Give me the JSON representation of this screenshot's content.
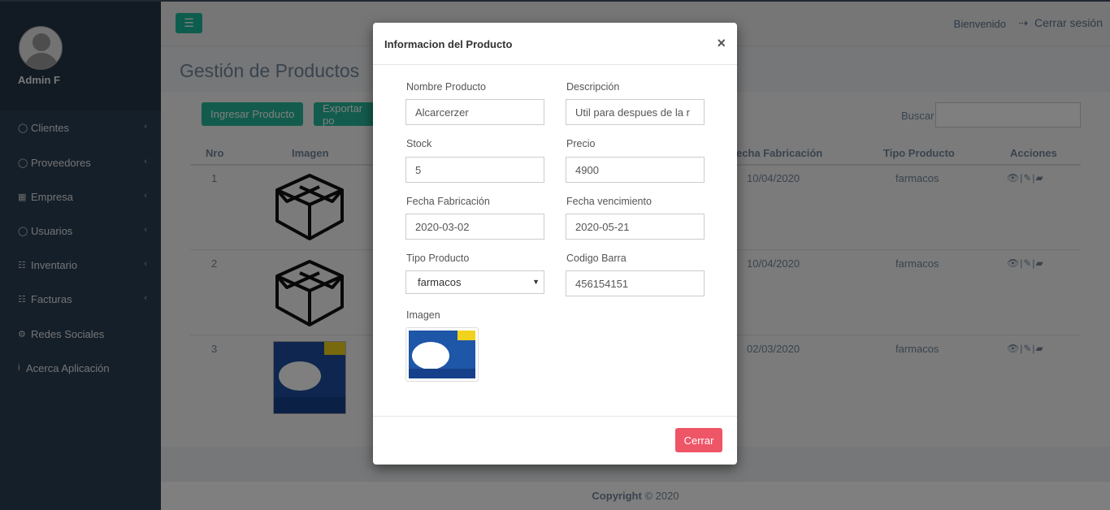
{
  "sidebar": {
    "user_name": "Admin F",
    "items": [
      {
        "label": "Clientes",
        "icon": "user-icon"
      },
      {
        "label": "Proveedores",
        "icon": "user-icon"
      },
      {
        "label": "Empresa",
        "icon": "building-icon"
      },
      {
        "label": "Usuarios",
        "icon": "user-icon"
      },
      {
        "label": "Inventario",
        "icon": "cart-icon"
      },
      {
        "label": "Facturas",
        "icon": "cart-icon"
      },
      {
        "label": "Redes Sociales",
        "icon": "gear-icon"
      },
      {
        "label": "Acerca Aplicación",
        "icon": "info-icon"
      }
    ]
  },
  "topbar": {
    "welcome": "Bienvenido",
    "logout": "Cerrar sesión"
  },
  "page": {
    "title": "Gestión de Productos",
    "add_button": "Ingresar Producto",
    "export_button": "Exportar po",
    "search_label": "Buscar"
  },
  "table": {
    "headers": {
      "nro": "Nro",
      "imagen": "Imagen",
      "fecha_fabricacion": "echa Fabricación",
      "tipo_producto": "Tipo Producto",
      "acciones": "Acciones"
    },
    "rows": [
      {
        "nro": "1",
        "fecha": "10/04/2020",
        "tipo": "farmacos",
        "image": "box-icon"
      },
      {
        "nro": "2",
        "fecha": "10/04/2020",
        "tipo": "farmacos",
        "image": "box-icon"
      },
      {
        "nro": "3",
        "fecha": "02/03/2020",
        "tipo": "farmacos",
        "image": "product-photo"
      }
    ]
  },
  "modal": {
    "title": "Informacion del Producto",
    "close_symbol": "×",
    "labels": {
      "nombre": "Nombre Producto",
      "descripcion": "Descripción",
      "stock": "Stock",
      "precio": "Precio",
      "fecha_fabricacion": "Fecha Fabricación",
      "fecha_vencimiento": "Fecha vencimiento",
      "tipo_producto": "Tipo Producto",
      "codigo_barra": "Codigo Barra",
      "imagen": "Imagen"
    },
    "values": {
      "nombre": "Alcarcerzer",
      "descripcion": "Util para despues de la r",
      "stock": "5",
      "precio": "4900",
      "fecha_fabricacion": "2020-03-02",
      "fecha_vencimiento": "2020-05-21",
      "tipo_producto": "farmacos",
      "codigo_barra": "456154151"
    },
    "close_button": "Cerrar"
  },
  "footer": {
    "copyright_bold": "Copyright",
    "copyright_rest": "© 2020"
  },
  "colors": {
    "sidebar": "#2a3f54",
    "accent_green": "#26b99a",
    "danger": "#ee5566"
  }
}
